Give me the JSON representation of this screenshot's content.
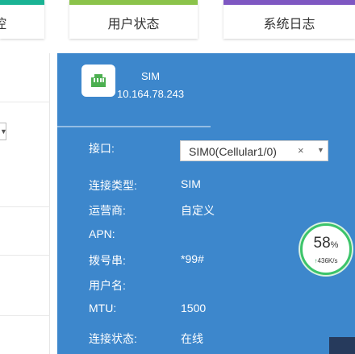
{
  "tabs": {
    "left_partial": "控",
    "user_status": "用户状态",
    "system_log": "系统日志"
  },
  "sim": {
    "name": "SIM",
    "ip": "10.164.78.243"
  },
  "fields": {
    "interface_label": "接口:",
    "interface_value": "SIM0(Cellular1/0)",
    "clear_icon": "×",
    "dropdown_icon": "▼",
    "conn_type_label": "连接类型:",
    "conn_type_value": "SIM",
    "carrier_label": "运营商:",
    "carrier_value": "自定义",
    "apn_label": "APN:",
    "dial_label": "拨号串:",
    "dial_value": "*99#",
    "username_label": "用户名:",
    "mtu_label": "MTU:",
    "mtu_value": "1500",
    "conn_status_label": "连接状态:",
    "conn_status_value": "在线"
  },
  "gauge": {
    "percent": "58",
    "percent_unit": "%",
    "up_arrow": "↑",
    "speed": "436K/s"
  },
  "colors": {
    "panel": "#3d87cc",
    "tab_left": "#1ab394",
    "tab_user": "#8bc34a",
    "tab_log": "#7e57c2",
    "gauge_ring": "#3cc46a"
  },
  "icons": [
    "ethernet-port-icon",
    "clear-icon",
    "dropdown-arrow-icon",
    "upload-arrow-icon"
  ]
}
